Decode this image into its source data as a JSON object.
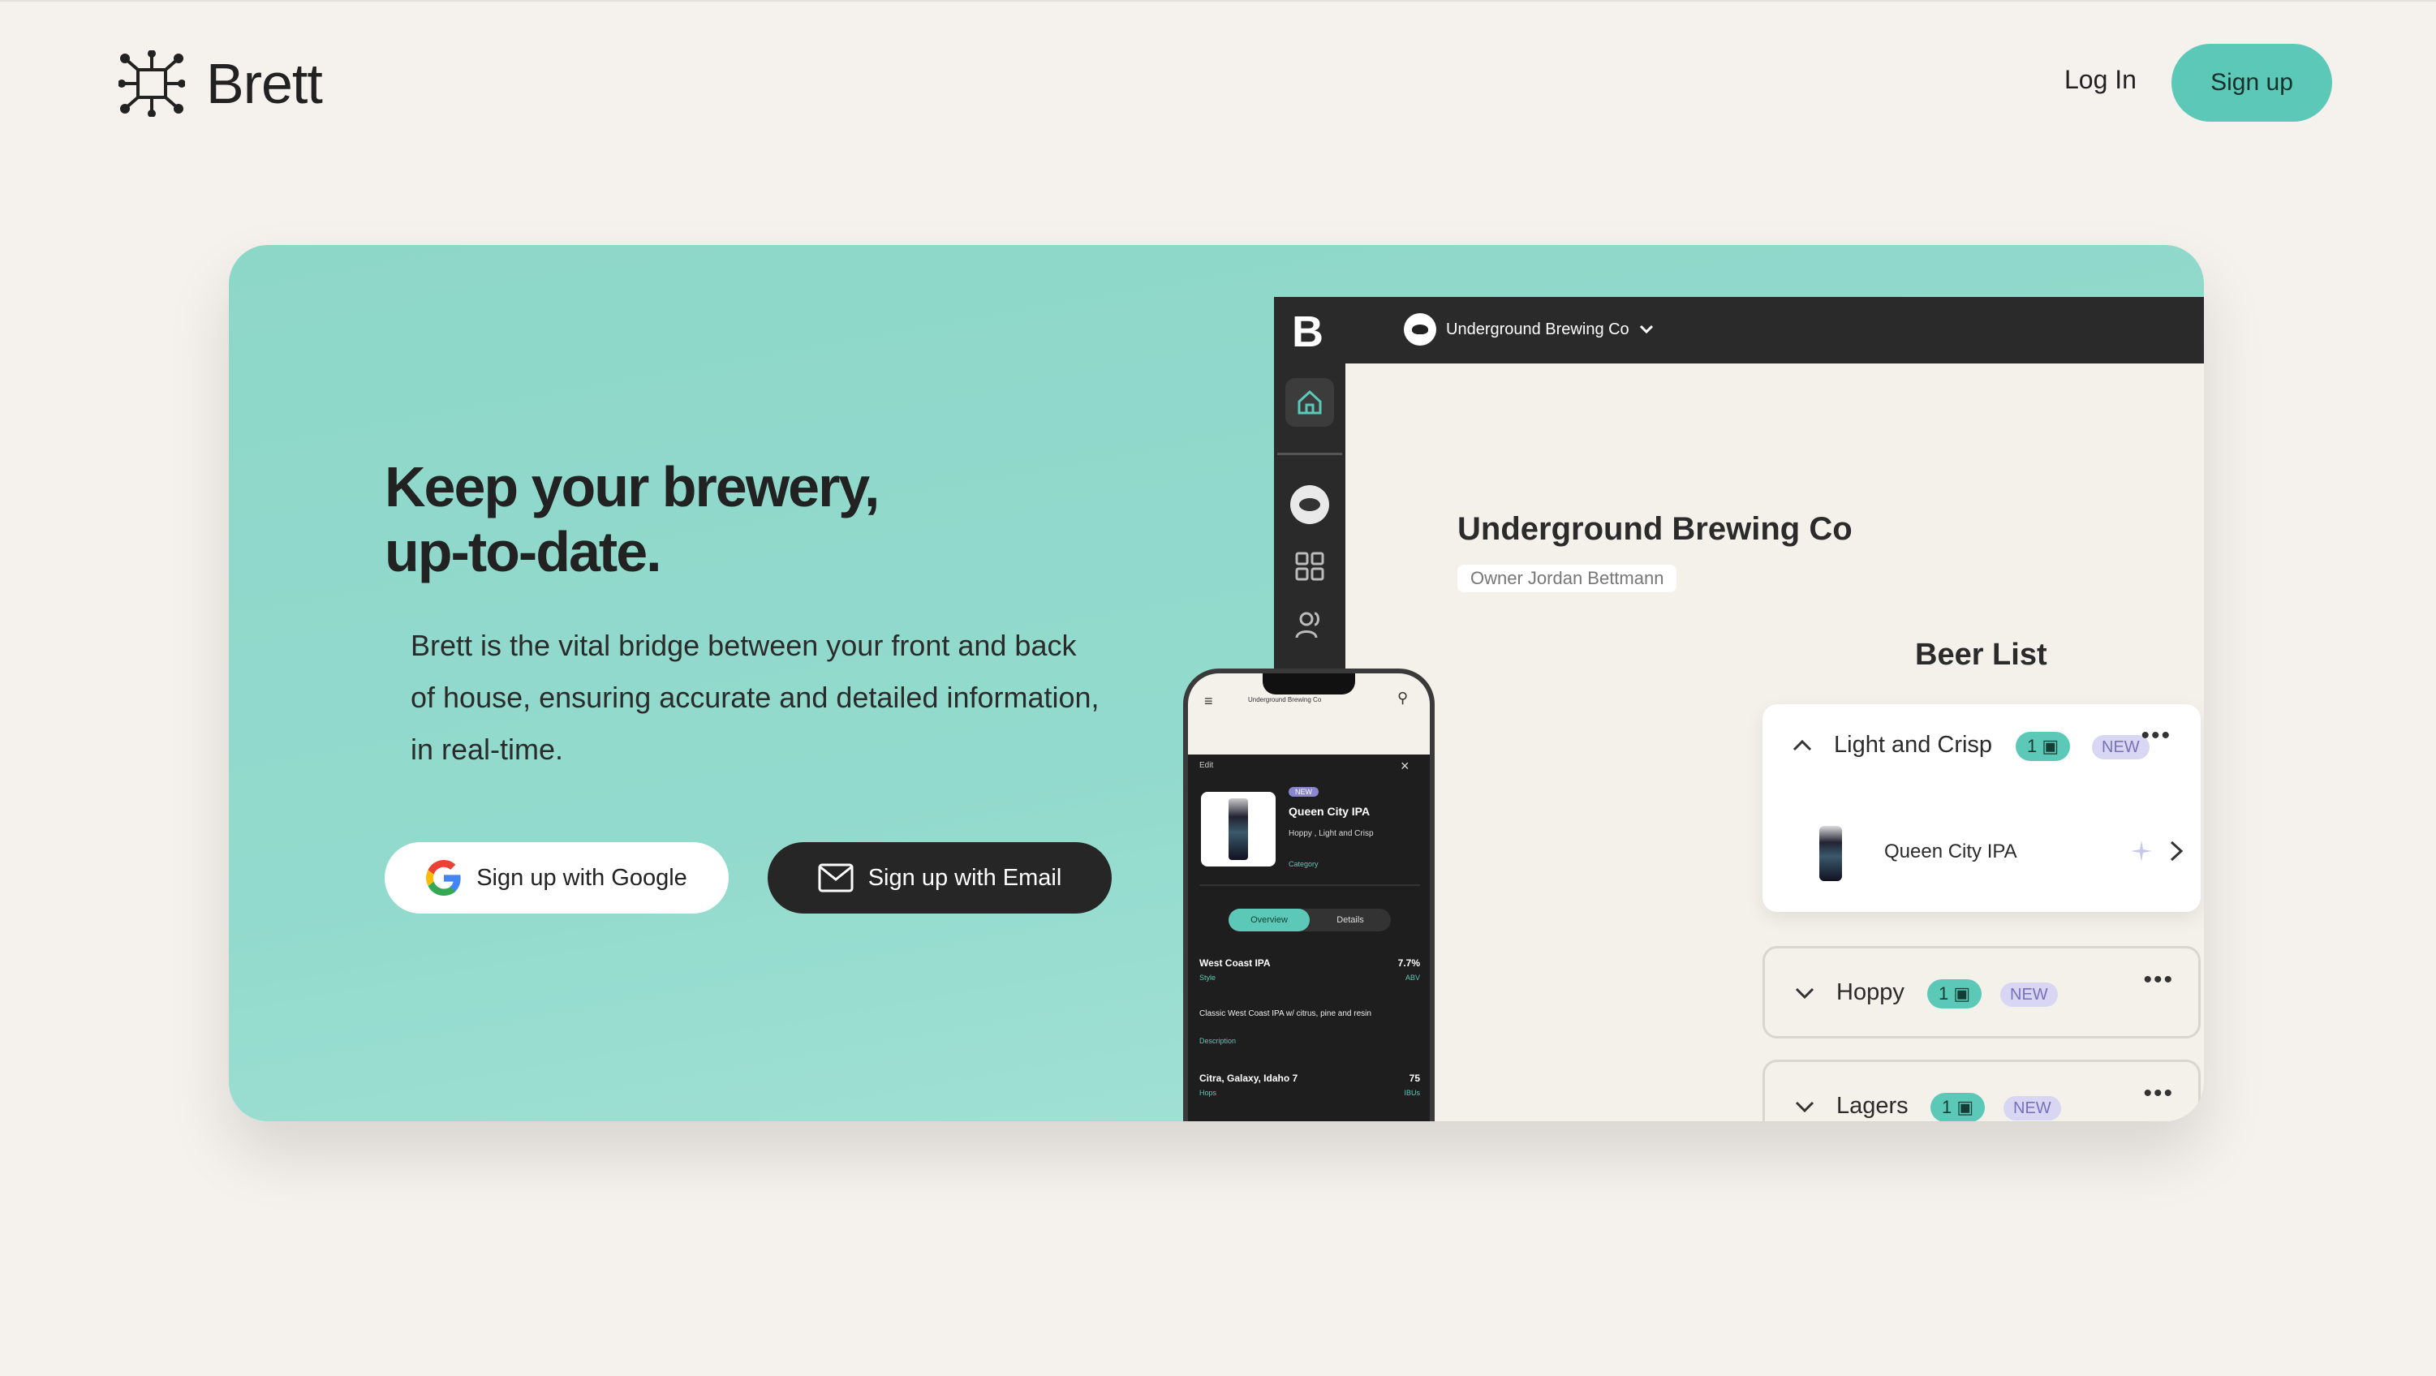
{
  "header": {
    "brand": "Brett",
    "login_label": "Log In",
    "signup_label": "Sign up"
  },
  "hero": {
    "headline_line1": "Keep your brewery,",
    "headline_line2": "up-to-date.",
    "description": "Brett is the vital bridge between your front and back of house, ensuring accurate and detailed information, in real-time.",
    "google_button": "Sign up with Google",
    "email_button": "Sign up with Email"
  },
  "app_mockup": {
    "logo_letter": "B",
    "brewery_selector": "Underground Brewing Co",
    "title": "Underground Brewing Co",
    "owner": "Owner Jordan Bettmann",
    "beer_list_title": "Beer List",
    "categories": [
      {
        "name": "Light and Crisp",
        "count": "1",
        "badge": "NEW",
        "items": [
          {
            "name": "Queen City IPA"
          }
        ]
      },
      {
        "name": "Hoppy",
        "count": "1",
        "badge": "NEW"
      },
      {
        "name": "Lagers",
        "count": "1",
        "badge": "NEW"
      }
    ]
  },
  "phone_mockup": {
    "top_title": "Underground Brewing Co",
    "edit_label": "Edit",
    "badge": "NEW",
    "beer_name": "Queen City IPA",
    "categories_text": "Hoppy , Light and Crisp",
    "category_label": "Category",
    "tab_overview": "Overview",
    "tab_details": "Details",
    "style_value": "West Coast IPA",
    "style_label": "Style",
    "abv_value": "7.7%",
    "abv_label": "ABV",
    "description_value": "Classic West Coast IPA w/ citrus, pine and resin",
    "description_label": "Description",
    "hops_value": "Citra, Galaxy, Idaho 7",
    "hops_label": "Hops",
    "ibu_value": "75",
    "ibu_label": "IBUs"
  },
  "colors": {
    "background": "#f5f1ec",
    "accent": "#5cc9b8",
    "hero": "#8dd7c9",
    "dark": "#262626"
  }
}
